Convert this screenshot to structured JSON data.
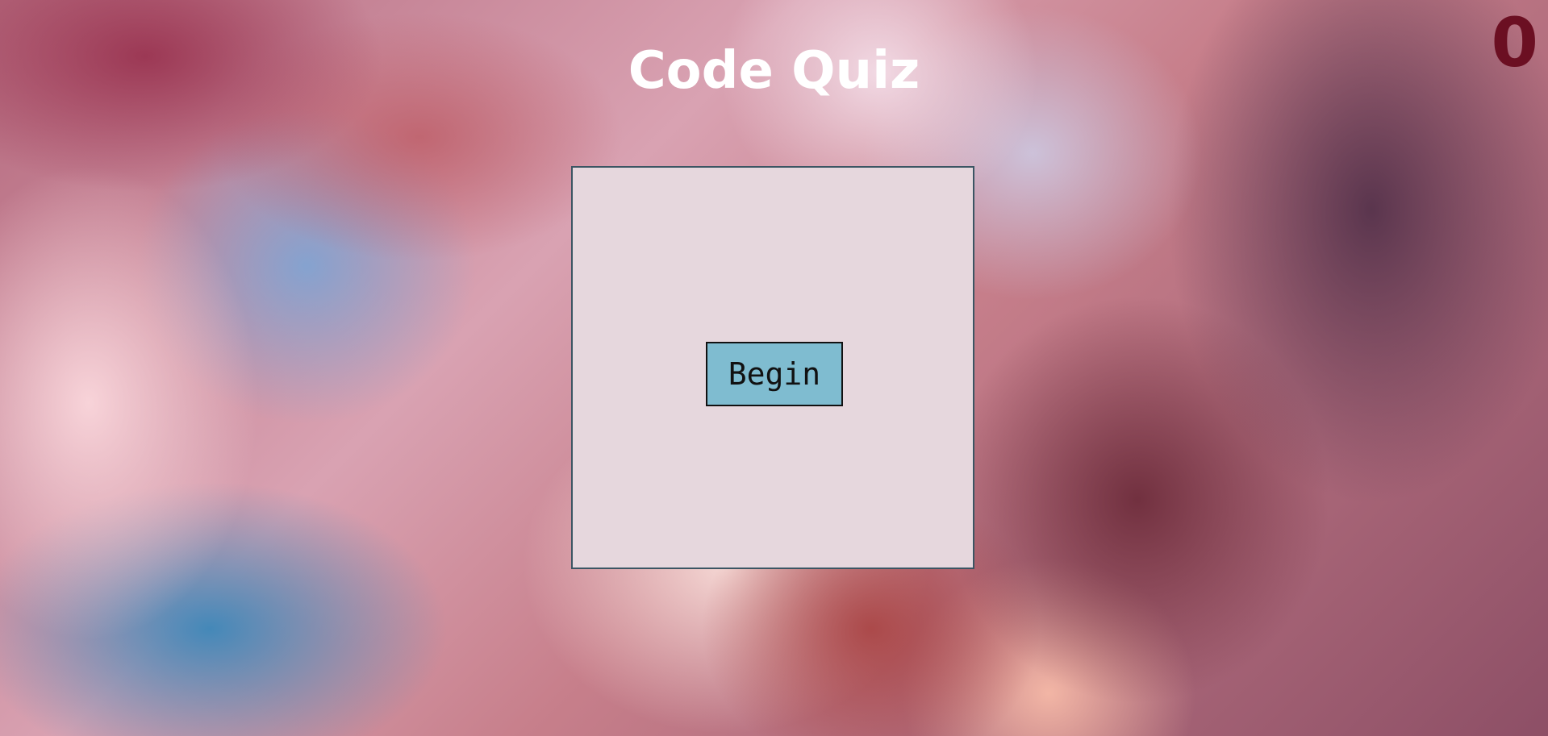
{
  "header": {
    "title": "Code Quiz"
  },
  "score": {
    "value": "0"
  },
  "quiz": {
    "begin_label": "Begin"
  },
  "colors": {
    "title": "#ffffff",
    "score": "#6b0f22",
    "card_background": "#e6d7dd",
    "button_background": "#7fbcd0"
  }
}
